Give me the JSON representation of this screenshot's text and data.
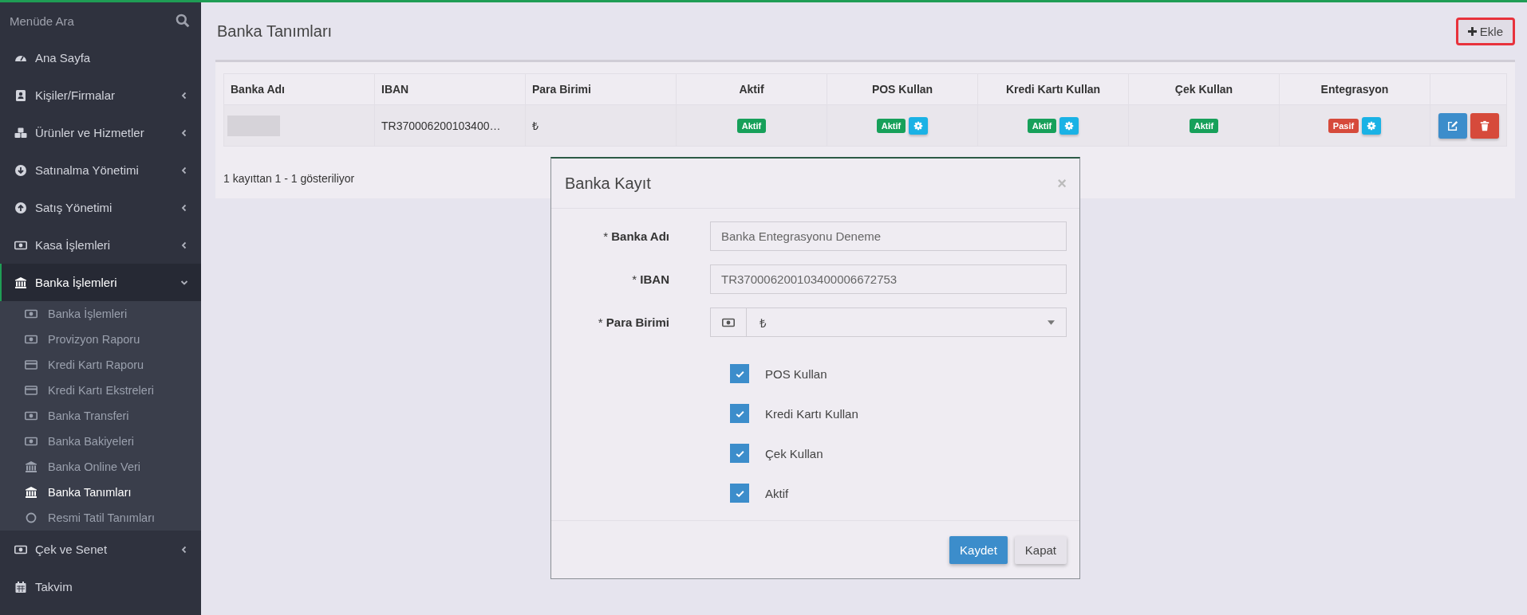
{
  "sidebar": {
    "search_placeholder": "Menüde Ara",
    "items": [
      {
        "label": "Ana Sayfa",
        "kind": "gauge",
        "selected": false
      },
      {
        "label": "Kişiler/Firmalar",
        "kind": "contact",
        "selected": false,
        "expanded": false
      },
      {
        "label": "Ürünler ve Hizmetler",
        "kind": "cubes",
        "selected": false,
        "expanded": false
      },
      {
        "label": "Satınalma Yönetimi",
        "kind": "down",
        "selected": false,
        "expanded": false
      },
      {
        "label": "Satış Yönetimi",
        "kind": "up",
        "selected": false,
        "expanded": false
      },
      {
        "label": "Kasa İşlemleri",
        "kind": "money",
        "selected": false,
        "expanded": false
      },
      {
        "label": "Banka İşlemleri",
        "kind": "bank",
        "selected": true,
        "expanded": true,
        "children": [
          {
            "label": "Banka İşlemleri",
            "kind": "money",
            "selected": false
          },
          {
            "label": "Provizyon Raporu",
            "kind": "money",
            "selected": false
          },
          {
            "label": "Kredi Kartı Raporu",
            "kind": "card",
            "selected": false
          },
          {
            "label": "Kredi Kartı Ekstreleri",
            "kind": "card",
            "selected": false
          },
          {
            "label": "Banka Transferi",
            "kind": "money",
            "selected": false
          },
          {
            "label": "Banka Bakiyeleri",
            "kind": "money",
            "selected": false
          },
          {
            "label": "Banka Online Veri",
            "kind": "bank",
            "selected": false
          },
          {
            "label": "Banka Tanımları",
            "kind": "bank",
            "selected": true
          },
          {
            "label": "Resmi Tatil Tanımları",
            "kind": "circle",
            "selected": false
          }
        ]
      },
      {
        "label": "Çek ve Senet",
        "kind": "money",
        "selected": false,
        "expanded": false
      },
      {
        "label": "Takvim",
        "kind": "calendar",
        "selected": false
      }
    ]
  },
  "page": {
    "title": "Banka Tanımları",
    "add_button": {
      "label": "Ekle",
      "highlighted": true
    }
  },
  "table": {
    "columns": [
      "Banka Adı",
      "IBAN",
      "Para Birimi",
      "Aktif",
      "POS Kullan",
      "Kredi Kartı Kullan",
      "Çek Kullan",
      "Entegrasyon"
    ],
    "rows": [
      {
        "cells": [
          {
            "kind": "blurred"
          },
          {
            "kind": "text",
            "text": "TR370006200103400…"
          },
          {
            "kind": "text",
            "text": "₺"
          },
          {
            "kind": "status",
            "label": "Aktif",
            "active": true,
            "settings": false
          },
          {
            "kind": "status",
            "label": "Aktif",
            "active": true,
            "settings": true
          },
          {
            "kind": "status",
            "label": "Aktif",
            "active": true,
            "settings": true
          },
          {
            "kind": "status",
            "label": "Aktif",
            "active": true,
            "settings": false
          },
          {
            "kind": "status",
            "label": "Pasif",
            "active": false,
            "settings": true
          },
          {
            "kind": "actions"
          }
        ]
      }
    ],
    "info": "1 kayıttan 1 - 1 gösteriliyor"
  },
  "modal": {
    "title": "Banka Kayıt",
    "close": "×",
    "fields": [
      {
        "label": "* **Banka Adı**",
        "kind": "text",
        "value": "Banka Entegrasyonu Deneme"
      },
      {
        "label": "* **IBAN**",
        "kind": "text",
        "value": "TR370006200103400006672753"
      },
      {
        "label": "* **Para Birimi**",
        "kind": "select",
        "value": "₺"
      }
    ],
    "checks": [
      {
        "label": "POS Kullan",
        "checked": true
      },
      {
        "label": "Kredi Kartı Kullan",
        "checked": true
      },
      {
        "label": "Çek Kullan",
        "checked": true
      },
      {
        "label": "Aktif",
        "checked": true
      }
    ],
    "buttons": [
      {
        "label": "Kaydet",
        "kind": "primary"
      },
      {
        "label": "Kapat",
        "kind": "default"
      }
    ]
  }
}
